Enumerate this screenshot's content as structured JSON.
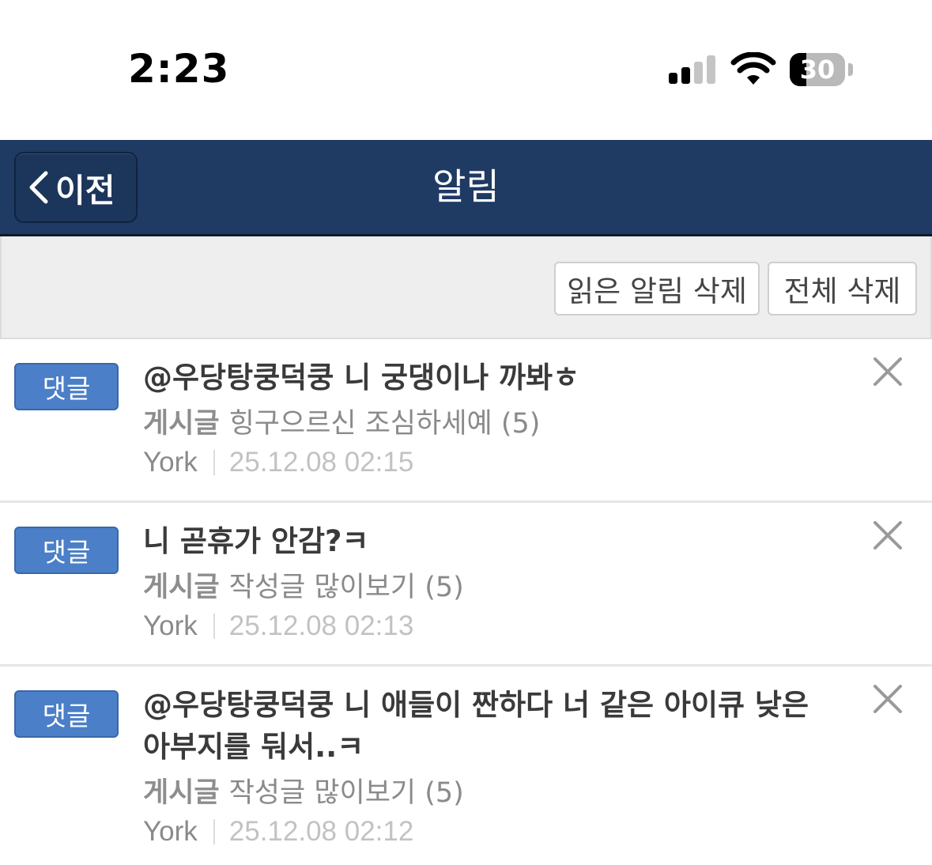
{
  "status_bar": {
    "time": "2:23",
    "battery": "30",
    "battery_level": 0.3
  },
  "nav": {
    "back_label": "이전",
    "title": "알림"
  },
  "toolbar": {
    "delete_read_label": "읽은 알림 삭제",
    "delete_all_label": "전체 삭제"
  },
  "notifications": [
    {
      "badge": "댓글",
      "title": "@우당탕쿵덕쿵 니 궁댕이나 까봐ㅎ",
      "post_label": "게시글",
      "post_title": "힝구으르신 조심하세예 (5)",
      "author": "York",
      "date": "25.12.08 02:15"
    },
    {
      "badge": "댓글",
      "title": "니 곧휴가 안감?ㅋ",
      "post_label": "게시글",
      "post_title": "작성글 많이보기 (5)",
      "author": "York",
      "date": "25.12.08 02:13"
    },
    {
      "badge": "댓글",
      "title": "@우당탕쿵덕쿵 니 애들이 짠하다 너 같은 아이큐 낮은 아부지를 둬서..ㅋ",
      "post_label": "게시글",
      "post_title": "작성글 많이보기 (5)",
      "author": "York",
      "date": "25.12.08 02:12"
    }
  ],
  "colors": {
    "nav_bg": "#1f3a63",
    "badge_bg": "#4b7fc7",
    "toolbar_bg": "#eeeeee"
  }
}
